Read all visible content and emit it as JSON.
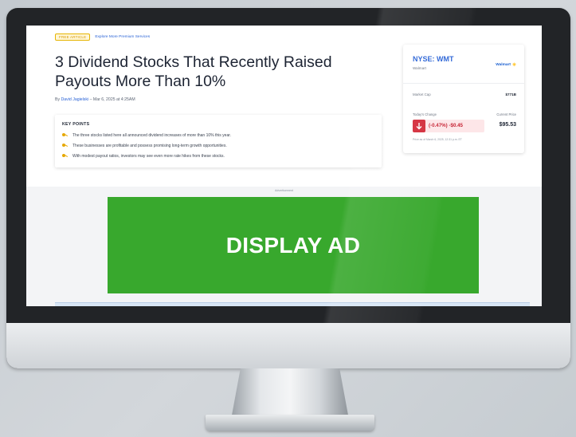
{
  "article": {
    "premium_badge": "Free Article",
    "explore_link": "Explore More Premium Services",
    "headline": "3 Dividend Stocks That Recently Raised Payouts More Than 10%",
    "byline_prefix": "By",
    "author": "David Jagielski",
    "date": "– Mar 6, 2025 at 4:25AM"
  },
  "key_points": {
    "title": "KEY POINTS",
    "items": [
      "The three stocks listed here all announced dividend increases of more than 10% this year.",
      "These businesses are profitable and possess promising long-term growth opportunities.",
      "With modest payout ratios, investors may see even more rate hikes from these stocks."
    ]
  },
  "stock_card": {
    "ticker": "NYSE: WMT",
    "company": "Walmart",
    "brand_logo": "Walmart",
    "market_cap_label": "Market Cap",
    "market_cap_value": "$771B",
    "todays_change_label": "Today's Change",
    "current_price_label": "Current Price",
    "change": "(-0.47%) -$0.45",
    "price": "$95.53",
    "price_note": "Price as of March 6, 2025, 12:31 p.m. ET",
    "change_color": "#c62233"
  },
  "ad": {
    "label": "Advertisement",
    "text": "DISPLAY AD",
    "color": "#38a82d"
  }
}
